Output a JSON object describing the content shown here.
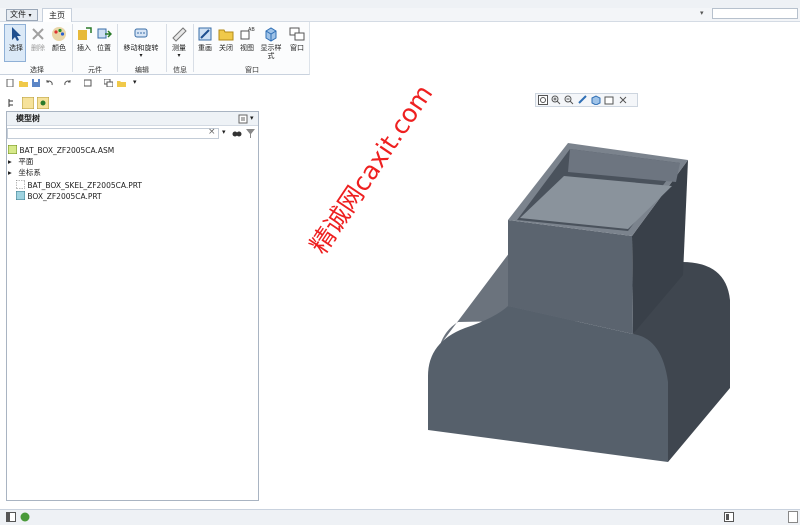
{
  "menu": {
    "file": "文件",
    "home_tab": "主页"
  },
  "ribbon": {
    "select": "选择",
    "delete": "删除",
    "color": "颜色",
    "insert": "插入",
    "position": "位置",
    "move_rotate": "移动和旋转",
    "measure": "测量",
    "repaint": "重画",
    "close": "关闭",
    "view": "视图",
    "display_style": "显示样式",
    "window": "窗口",
    "group_select": "选择",
    "group_component": "元件",
    "group_edit": "编辑",
    "group_info": "信息",
    "group_window": "窗口"
  },
  "tree": {
    "title": "模型树",
    "items": [
      {
        "label": "BAT_BOX_ZF2005CA.ASM",
        "expander": ""
      },
      {
        "label": "平面",
        "expander": "▸"
      },
      {
        "label": "坐标系",
        "expander": "▸"
      },
      {
        "label": "BAT_BOX_SKEL_ZF2005CA.PRT",
        "expander": ""
      },
      {
        "label": "BOX_ZF2005CA.PRT",
        "expander": ""
      }
    ]
  },
  "watermark": "精诚网caxit.com",
  "colors": {
    "model_top": "#6f7781",
    "model_front": "#4f5763",
    "model_side": "#3a414b",
    "accent": "#2f6fb5"
  }
}
